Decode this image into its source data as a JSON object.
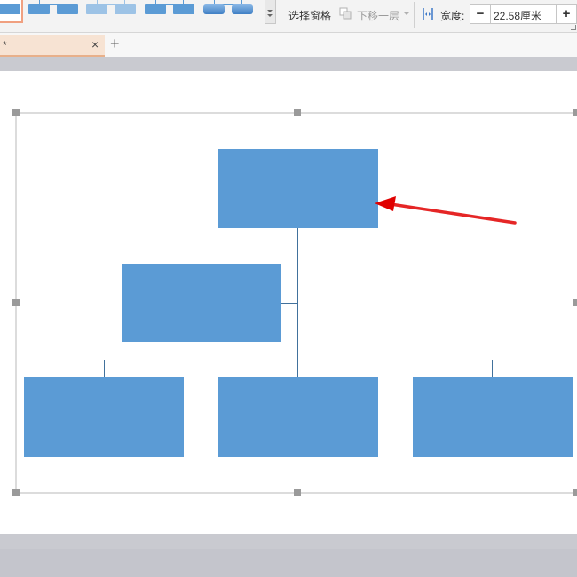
{
  "toolbar": {
    "selection_pane_label": "选择窗格",
    "send_backward_label": "下移一层",
    "width_label": "宽度:",
    "width_value": "22.58厘米",
    "minus_label": "−",
    "plus_label": "+"
  },
  "tabs": [
    {
      "title": "*",
      "close_label": "×"
    }
  ],
  "new_tab_label": "+",
  "colors": {
    "shape_fill": "#5b9bd5",
    "connector": "#41719c",
    "arrow": "#e00000",
    "tab_active": "#f7e3d3"
  },
  "diagram": {
    "type": "org-chart",
    "levels": [
      {
        "level": 1,
        "boxes": 1
      },
      {
        "level": 2,
        "boxes": 1,
        "role": "assistant"
      },
      {
        "level": 3,
        "boxes": 3
      }
    ],
    "selected": true
  }
}
